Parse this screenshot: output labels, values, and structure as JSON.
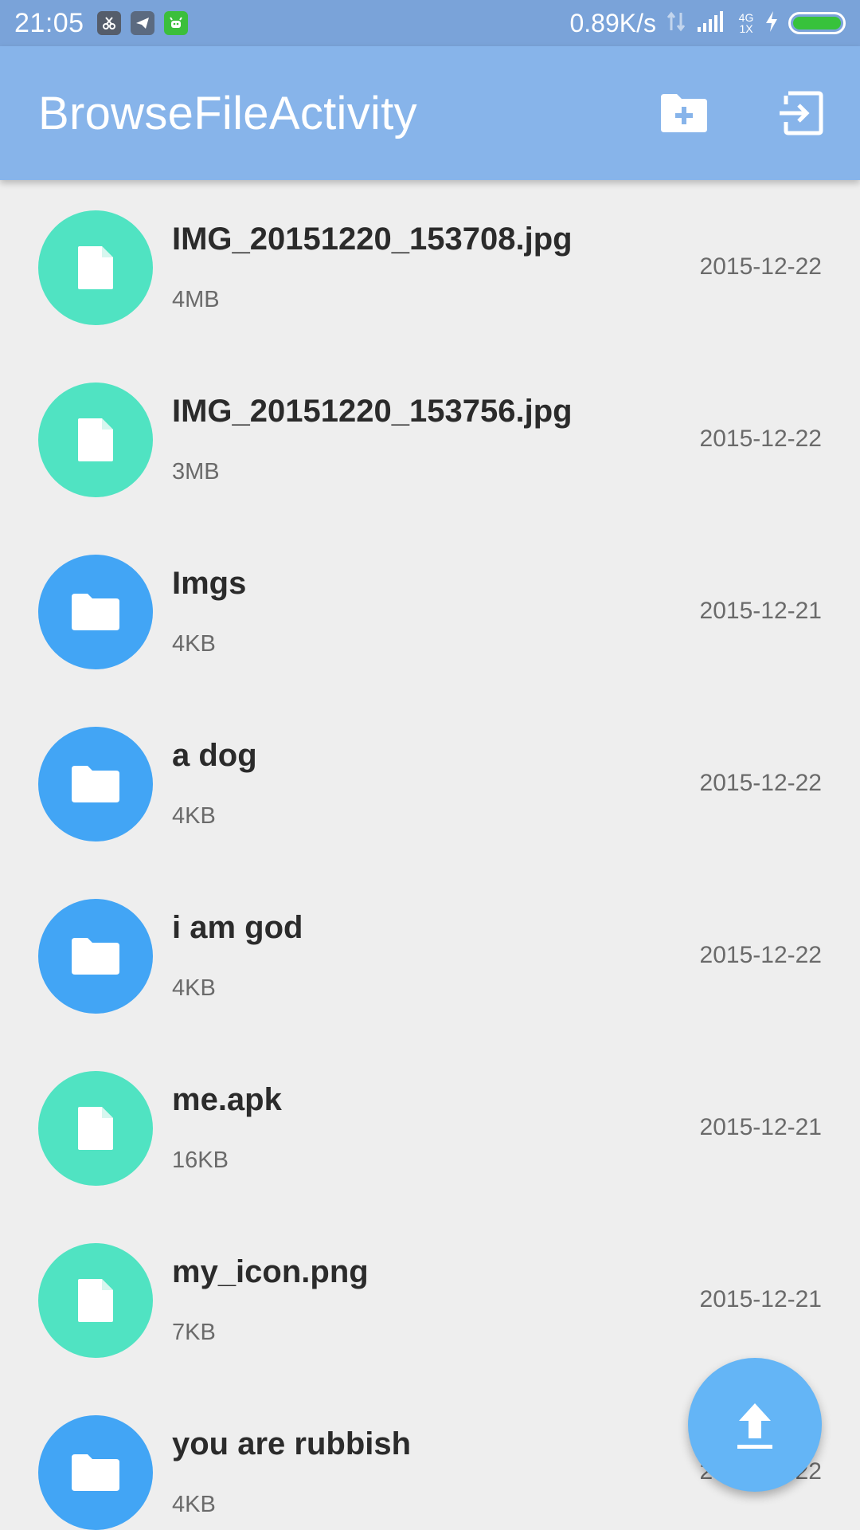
{
  "status_bar": {
    "time": "21:05",
    "net_speed": "0.89K/s",
    "network": "4G 1X",
    "battery_level": 1.0,
    "notification_icons": [
      "scissors-app-icon",
      "telegram-icon",
      "android-robot-icon"
    ]
  },
  "app_bar": {
    "title": "BrowseFileActivity",
    "actions": [
      "new-folder-icon",
      "exit-icon"
    ]
  },
  "files": [
    {
      "name": "IMG_20151220_153708.jpg",
      "size": "4MB",
      "date": "2015-12-22",
      "type": "file"
    },
    {
      "name": "IMG_20151220_153756.jpg",
      "size": "3MB",
      "date": "2015-12-22",
      "type": "file"
    },
    {
      "name": "Imgs",
      "size": "4KB",
      "date": "2015-12-21",
      "type": "folder"
    },
    {
      "name": "a dog",
      "size": "4KB",
      "date": "2015-12-22",
      "type": "folder"
    },
    {
      "name": "i am god",
      "size": "4KB",
      "date": "2015-12-22",
      "type": "folder"
    },
    {
      "name": "me.apk",
      "size": "16KB",
      "date": "2015-12-21",
      "type": "file"
    },
    {
      "name": "my_icon.png",
      "size": "7KB",
      "date": "2015-12-21",
      "type": "file"
    },
    {
      "name": "you are rubbish",
      "size": "4KB",
      "date": "2015-12-22",
      "type": "folder"
    }
  ],
  "fab": {
    "icon": "upload-icon"
  },
  "colors": {
    "status_bar": "#7aa3d9",
    "app_bar": "#87b4ea",
    "file_avatar": "#50e3c2",
    "folder_avatar": "#42a5f5",
    "fab": "#64b5f6",
    "background": "#eeeeee"
  }
}
